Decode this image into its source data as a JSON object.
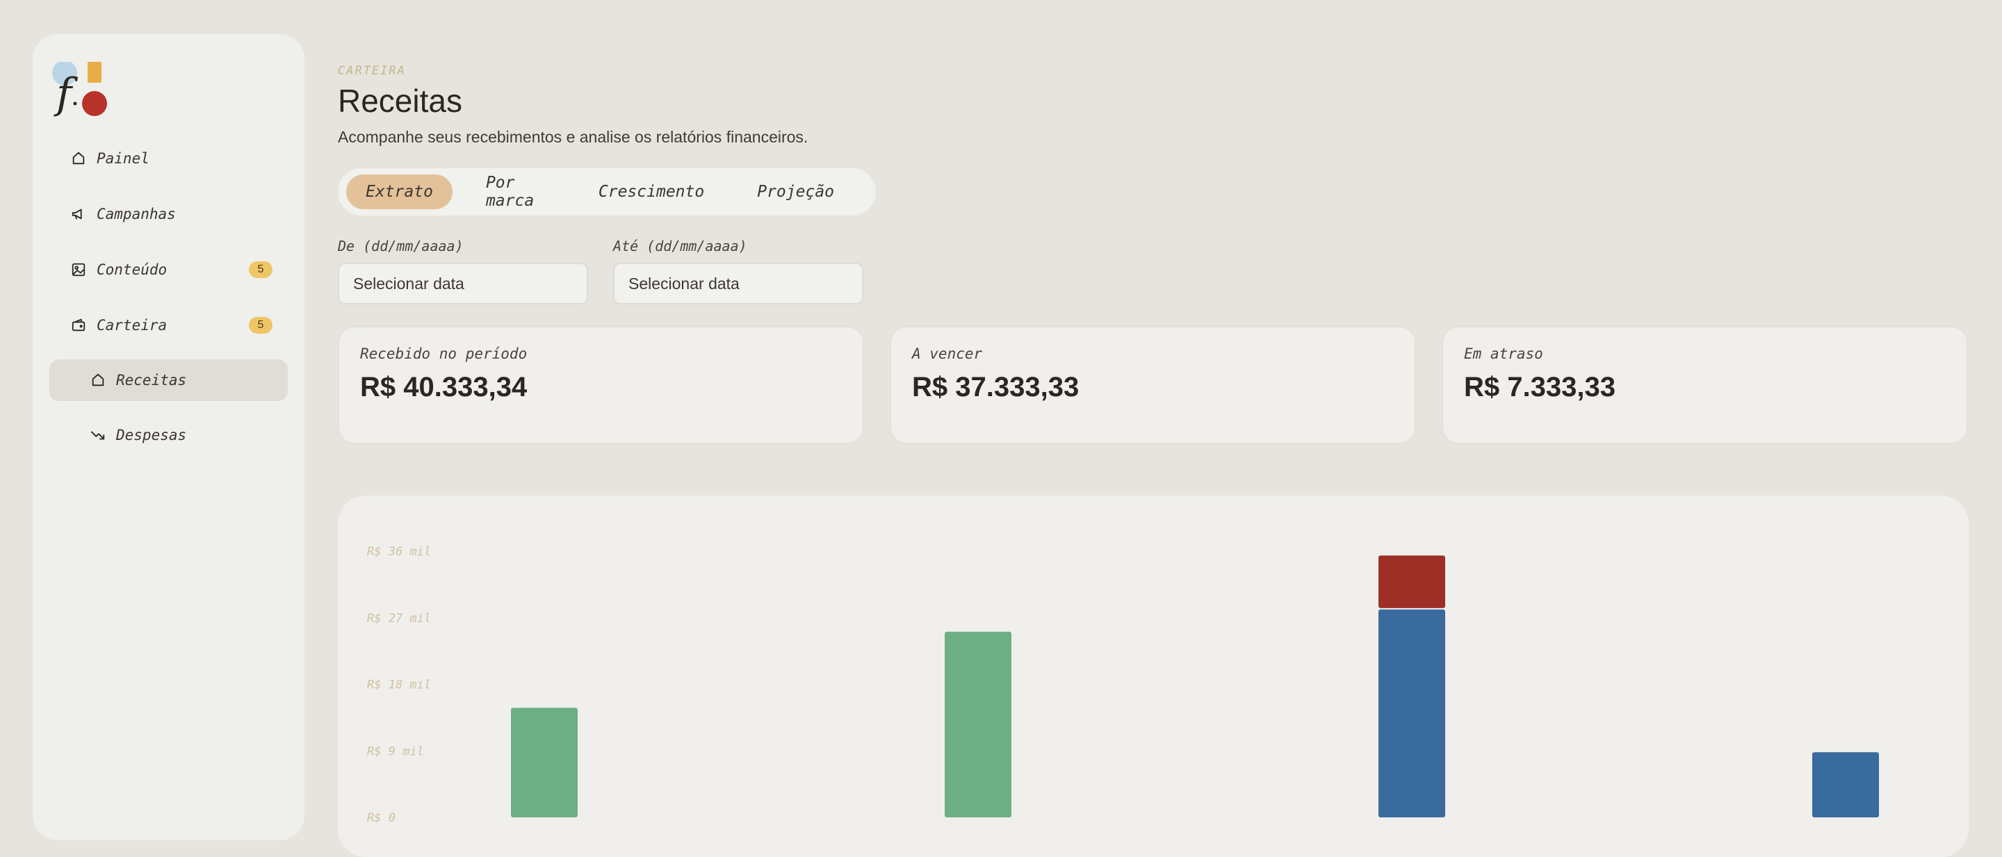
{
  "sidebar": {
    "items": [
      {
        "label": "Painel",
        "icon": "home-icon"
      },
      {
        "label": "Campanhas",
        "icon": "megaphone-icon"
      },
      {
        "label": "Conteúdo",
        "icon": "image-icon",
        "badge": "5"
      },
      {
        "label": "Carteira",
        "icon": "wallet-icon",
        "badge": "5"
      },
      {
        "label": "Receitas",
        "icon": "home-icon",
        "active": true
      },
      {
        "label": "Despesas",
        "icon": "trending-down-icon"
      }
    ],
    "badge_color": "#efc665",
    "active_bg": "#e0ddd7"
  },
  "header": {
    "eyebrow": "CARTEIRA",
    "title": "Receitas",
    "subtitle": "Acompanhe seus recebimentos e analise os relatórios financeiros."
  },
  "tabs": [
    {
      "label": "Extrato",
      "active": true
    },
    {
      "label": "Por marca"
    },
    {
      "label": "Crescimento"
    },
    {
      "label": "Projeção"
    }
  ],
  "filters": {
    "from": {
      "label": "De (dd/mm/aaaa)",
      "placeholder": "Selecionar data"
    },
    "to": {
      "label": "Até (dd/mm/aaaa)",
      "placeholder": "Selecionar data"
    }
  },
  "cards": [
    {
      "label": "Recebido no período",
      "value": "R$ 40.333,34"
    },
    {
      "label": "A vencer",
      "value": "R$ 37.333,33"
    },
    {
      "label": "Em atraso",
      "value": "R$ 7.333,33"
    }
  ],
  "colors": {
    "accent": "#e3c29a",
    "green": "#6daf85",
    "blue": "#3a6b9e",
    "red": "#9e2f27",
    "background": "#e7e4dd"
  },
  "chart_data": {
    "type": "bar",
    "stacked": true,
    "y_tick_labels": [
      "R$ 0",
      "R$ 9 mil",
      "R$ 18 mil",
      "R$ 27 mil",
      "R$ 36 mil"
    ],
    "y_ticks": [
      0,
      9000,
      18000,
      27000,
      36000
    ],
    "ylim": [
      0,
      36000
    ],
    "categories": [
      "",
      "",
      "",
      ""
    ],
    "series": [
      {
        "color": "#6daf85",
        "values": [
          15000,
          25300,
          0,
          0
        ]
      },
      {
        "color": "#3a6b9e",
        "values": [
          0,
          0,
          28300,
          9000
        ]
      },
      {
        "color": "#9e2f27",
        "values": [
          0,
          0,
          7300,
          0
        ]
      }
    ],
    "grid": false
  }
}
